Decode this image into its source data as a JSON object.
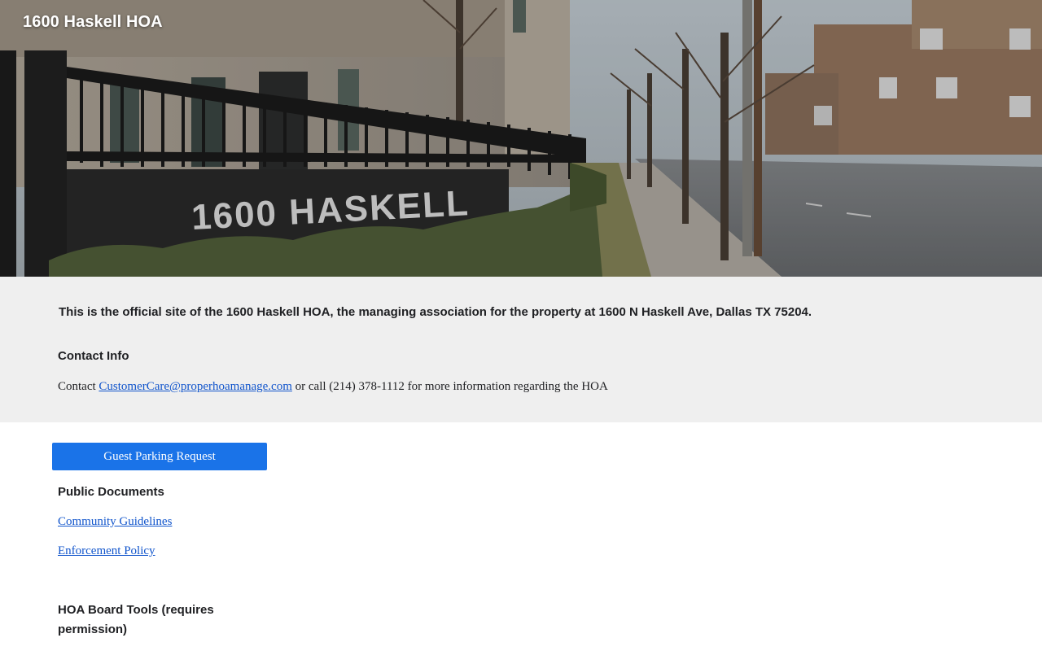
{
  "header": {
    "site_title": "1600 Haskell HOA",
    "banner_sign_text": "1600 HASKELL"
  },
  "info": {
    "intro": "This is the official site of the 1600 Haskell HOA, the managing association for the property at 1600 N Haskell Ave, Dallas TX 75204.",
    "contact_heading": "Contact Info",
    "contact_prefix": "Contact ",
    "contact_email": "CustomerCare@properhoamanage.com",
    "contact_suffix": " or call (214) 378-1112 for more information regarding the HOA"
  },
  "actions": {
    "parking_button": "Guest Parking Request"
  },
  "documents": {
    "heading": "Public Documents",
    "links": [
      "Community Guidelines",
      "Enforcement Policy"
    ]
  },
  "board": {
    "heading": "HOA Board Tools (requires permission)"
  },
  "colors": {
    "button": "#1a73e8",
    "link": "#1155cc",
    "info_background": "#efefef"
  }
}
